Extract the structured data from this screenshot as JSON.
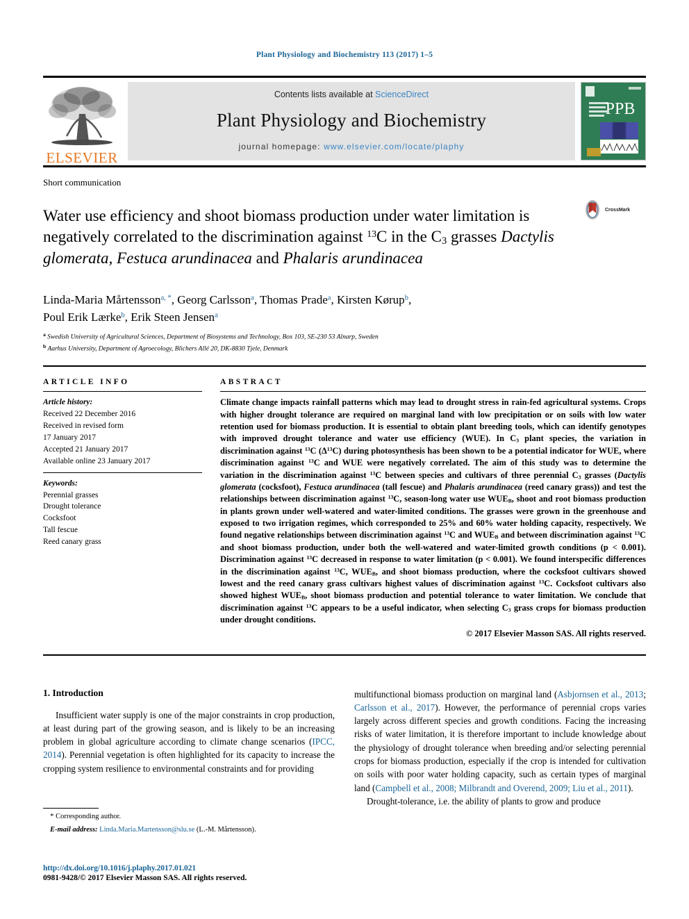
{
  "running_head": "Plant Physiology and Biochemistry 113 (2017) 1–5",
  "masthead": {
    "publisher_logo_text": "ELSEVIER",
    "contents_prefix": "Contents lists available at ",
    "contents_link": "ScienceDirect",
    "journal_title": "Plant Physiology and Biochemistry",
    "homepage_prefix": "journal homepage: ",
    "homepage_url": "www.elsevier.com/locate/plaphy",
    "cover_abbrev": "PPB",
    "cover_subtitle": "Plant Physiology and Biochemistry"
  },
  "article": {
    "type": "Short communication",
    "title_part1": "Water use efficiency and shoot biomass production under water limitation is negatively correlated to the discrimination against ",
    "title_sup1": "13",
    "title_part2": "C in the C",
    "title_sub1": "3",
    "title_part3": " grasses ",
    "title_italic1": "Dactylis glomerata, Festuca arundinacea",
    "title_part4": " and ",
    "title_italic2": "Phalaris arundinacea",
    "crossmark_label": "CrossMark"
  },
  "authors": {
    "line1": "Linda-Maria Mårtensson",
    "line1_sup": "a, *",
    "a2": "Georg Carlsson",
    "a2_sup": "a",
    "a3": "Thomas Prade",
    "a3_sup": "a",
    "a4": "Kirsten Kørup",
    "a4_sup": "b",
    "a5": "Poul Erik Lærke",
    "a5_sup": "b",
    "a6": "Erik Steen Jensen",
    "a6_sup": "a",
    "affiliation_a_marker": "a",
    "affiliation_a": "Swedish University of Agricultural Sciences, Department of Biosystems and Technology, Box 103, SE-230 53 Alnarp, Sweden",
    "affiliation_b_marker": "b",
    "affiliation_b": "Aarhus University, Department of Agroecology, Blichers Allé 20, DK-8830 Tjele, Denmark"
  },
  "article_info": {
    "heading": "ARTICLE INFO",
    "history_label": "Article history:",
    "history": [
      "Received 22 December 2016",
      "Received in revised form",
      "17 January 2017",
      "Accepted 21 January 2017",
      "Available online 23 January 2017"
    ],
    "keywords_label": "Keywords:",
    "keywords": [
      "Perennial grasses",
      "Drought tolerance",
      "Cocksfoot",
      "Tall fescue",
      "Reed canary grass"
    ]
  },
  "abstract": {
    "heading": "ABSTRACT",
    "p1": "Climate change impacts rainfall patterns which may lead to drought stress in rain-fed agricultural systems. Crops with higher drought tolerance are required on marginal land with low precipitation or on soils with low water retention used for biomass production. It is essential to obtain plant breeding tools, which can identify genotypes with improved drought tolerance and water use efficiency (WUE). In C",
    "s1": "3",
    "p2": " plant species, the variation in discrimination against ",
    "s2": "13",
    "p3": "C (Δ",
    "s3": "13",
    "p4": "C) during photosynthesis has been shown to be a potential indicator for WUE, where discrimination against ",
    "s4": "13",
    "p5": "C and WUE were negatively correlated. The aim of this study was to determine the variation in the discrimination against ",
    "s5": "13",
    "p6": "C between species and cultivars of three perennial C",
    "s6": "3",
    "p7": " grasses (",
    "i1": "Dactylis glomerata",
    "p8": " (cocksfoot), ",
    "i2": "Festuca arundinacea",
    "p9": " (tall fescue) and ",
    "i3": "Phalaris arundinacea",
    "p10": " (reed canary grass)) and test the relationships between discrimination against ",
    "s7": "13",
    "p11": "C, season-long water use WUE",
    "s8": "B",
    "p12": ", shoot and root biomass production in plants grown under well-watered and water-limited conditions. The grasses were grown in the greenhouse and exposed to two irrigation regimes, which corresponded to 25% and 60% water holding capacity, respectively. We found negative relationships between discrimination against ",
    "s9": "13",
    "p13": "C and WUE",
    "s10": "B",
    "p14": " and between discrimination against ",
    "s11": "13",
    "p15": "C and shoot biomass production, under both the well-watered and water-limited growth conditions (p < 0.001). Discrimination against ",
    "s12": "13",
    "p16": "C decreased in response to water limitation (p < 0.001). We found interspecific differences in the discrimination against ",
    "s13": "13",
    "p17": "C, WUE",
    "s14": "B",
    "p18": ", and shoot biomass production, where the cocksfoot cultivars showed lowest and the reed canary grass cultivars highest values of discrimination against ",
    "s15": "13",
    "p19": "C. Cocksfoot cultivars also showed highest WUE",
    "s16": "B",
    "p20": ", shoot biomass production and potential tolerance to water limitation. We conclude that discrimination against ",
    "s17": "13",
    "p21": "C appears to be a useful indicator, when selecting C",
    "s18": "3",
    "p22": " grass crops for biomass production under drought conditions.",
    "copyright": "© 2017 Elsevier Masson SAS. All rights reserved."
  },
  "intro": {
    "heading": "1. Introduction",
    "left_p1_a": "Insufficient water supply is one of the major constraints in crop production, at least during part of the growing season, and is likely to be an increasing problem in global agriculture according to climate change scenarios (",
    "left_ref1": "IPCC, 2014",
    "left_p1_b": "). Perennial vegetation is often highlighted for its capacity to increase the cropping system resilience to environmental constraints and for providing",
    "right_p1_a": "multifunctional biomass production on marginal land (",
    "right_ref1": "Asbjornsen et al., 2013",
    "right_sep1": "; ",
    "right_ref2": "Carlsson et al., 2017",
    "right_p1_b": "). However, the performance of perennial crops varies largely across different species and growth conditions. Facing the increasing risks of water limitation, it is therefore important to include knowledge about the physiology of drought tolerance when breeding and/or selecting perennial crops for biomass production, especially if the crop is intended for cultivation on soils with poor water holding capacity, such as certain types of marginal land (",
    "right_ref3": "Campbell et al., 2008; Milbrandt and Overend, 2009; Liu et al., 2011",
    "right_p1_c": ").",
    "right_p2": "Drought-tolerance, i.e. the ability of plants to grow and produce"
  },
  "footnote": {
    "star": "*",
    "corresponding": "Corresponding author.",
    "email_label": "E-mail address:",
    "email": "Linda.Maria.Martensson@slu.se",
    "email_owner": "(L.-M. Mårtensson)."
  },
  "footer": {
    "doi": "http://dx.doi.org/10.1016/j.plaphy.2017.01.021",
    "issn": "0981-9428/© 2017 Elsevier Masson SAS. All rights reserved."
  },
  "colors": {
    "link": "#1a6496",
    "sciencedirect": "#3a84c3",
    "elsevier_orange": "#E87722",
    "band_gray": "#e3e3e3",
    "cover_green": "#2f7d54"
  }
}
